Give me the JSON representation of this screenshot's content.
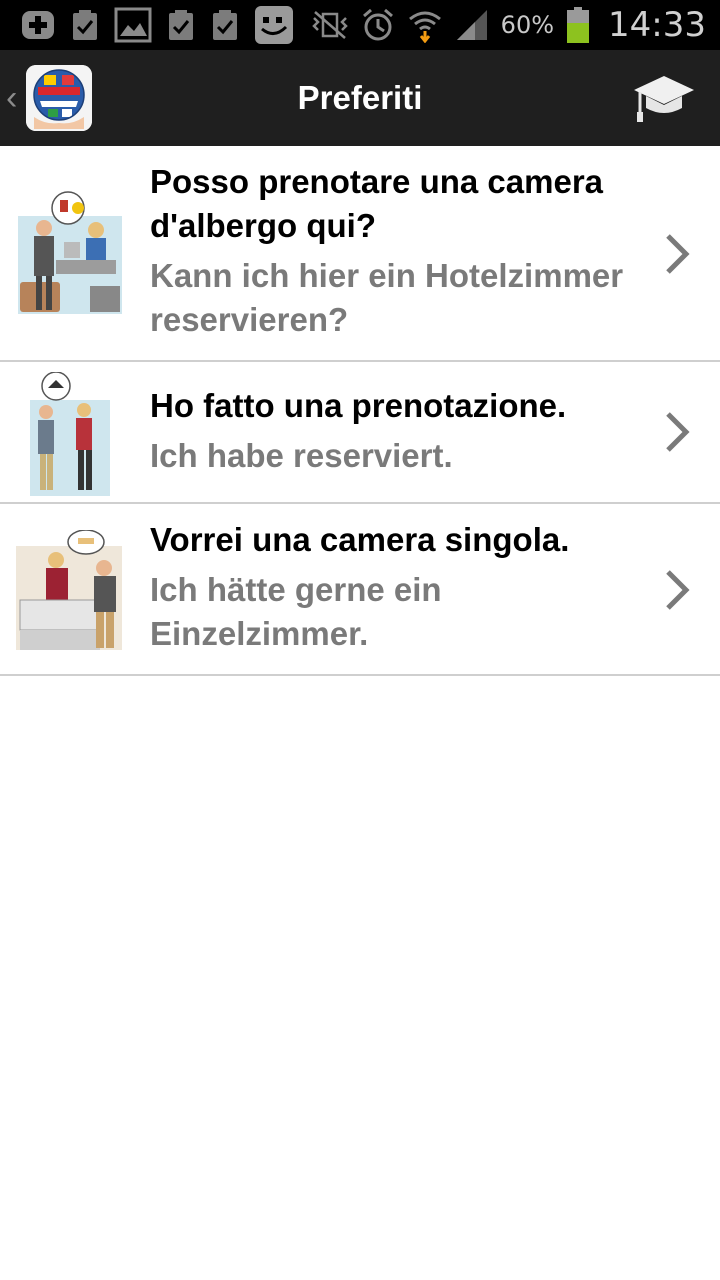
{
  "status_bar": {
    "icons_left": [
      "add-icon",
      "clipboard-check-icon",
      "image-icon",
      "clipboard-check-icon",
      "clipboard-check-icon",
      "smiley-app-icon"
    ],
    "icons_right": [
      "vibrate-icon",
      "alarm-icon",
      "wifi-icon",
      "signal-icon"
    ],
    "battery_percent": "60%",
    "battery_level": 0.6,
    "time": "14:33"
  },
  "action_bar": {
    "title": "Preferiti",
    "app_icon": "globe-flags-icon",
    "action_icon": "graduation-cap-icon"
  },
  "phrases": [
    {
      "italian": "Posso prenotare una camera d'albergo qui?",
      "german": "Kann ich hier ein Hotelzimmer reservieren?",
      "illustration": "hotel-reception-question-illustration"
    },
    {
      "italian": "Ho fatto una prenotazione.",
      "german": "Ich habe reserviert.",
      "illustration": "reservation-couple-illustration"
    },
    {
      "italian": "Vorrei una camera singola.",
      "german": "Ich hätte gerne ein Einzelzimmer.",
      "illustration": "single-room-reception-illustration"
    }
  ],
  "colors": {
    "status_bar_bg": "#000000",
    "action_bar_bg": "#1f1f1f",
    "divider": "#cfcfcf",
    "secondary_text": "#7a7a7a",
    "battery_fill": "#8dc21f"
  }
}
